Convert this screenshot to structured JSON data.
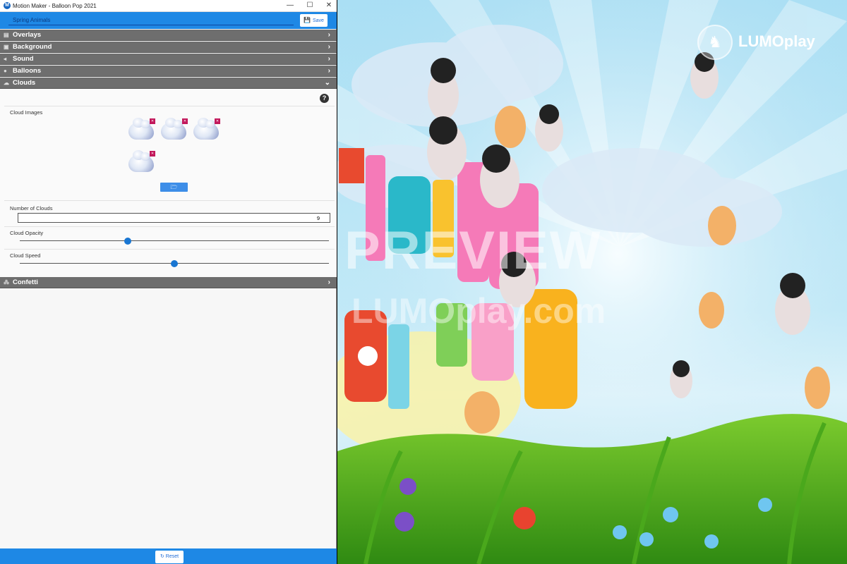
{
  "window": {
    "title": "Motion Maker - Balloon Pop 2021",
    "controls": {
      "minimize": "—",
      "maximize": "☐",
      "close": "✕"
    }
  },
  "toolbar": {
    "name_value": "Spring Animals",
    "save_label": "Save"
  },
  "sections": [
    {
      "label": "Overlays",
      "icon": "layers-icon",
      "expanded": false
    },
    {
      "label": "Background",
      "icon": "image-icon",
      "expanded": false
    },
    {
      "label": "Sound",
      "icon": "volume-icon",
      "expanded": false
    },
    {
      "label": "Balloons",
      "icon": "balloon-icon",
      "expanded": false
    },
    {
      "label": "Clouds",
      "icon": "cloud-icon",
      "expanded": true
    },
    {
      "label": "Confetti",
      "icon": "confetti-icon",
      "expanded": false
    }
  ],
  "clouds": {
    "images_label": "Cloud Images",
    "images_count": 4,
    "number_label": "Number of Clouds",
    "number_value": "9",
    "opacity_label": "Cloud Opacity",
    "opacity_value": 0.35,
    "speed_label": "Cloud Speed",
    "speed_value": 0.5
  },
  "footer": {
    "reset_label": "Reset"
  },
  "preview": {
    "watermark": "PREVIEW",
    "watermark_url": "LUMOplay.com",
    "brand_name": "LUMOplay"
  }
}
